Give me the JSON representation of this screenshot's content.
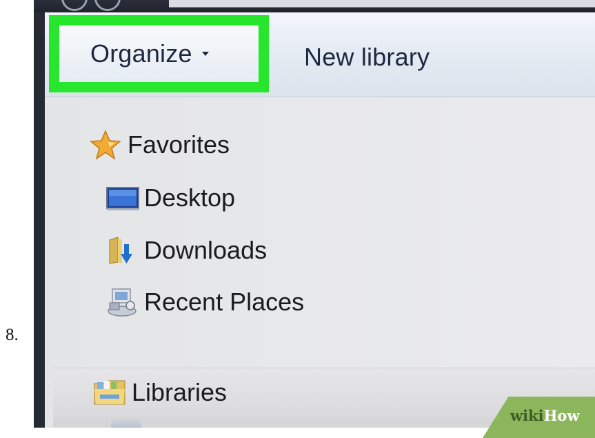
{
  "step": {
    "number": "8."
  },
  "toolbar": {
    "organize_label": "Organize",
    "new_library_label": "New library",
    "highlight_color": "#27e62d"
  },
  "navigation": {
    "favorites": {
      "label": "Favorites",
      "icon": "star-icon",
      "items": [
        {
          "label": "Desktop",
          "icon": "desktop-icon"
        },
        {
          "label": "Downloads",
          "icon": "downloads-folder-icon"
        },
        {
          "label": "Recent Places",
          "icon": "recent-places-icon"
        }
      ]
    },
    "libraries": {
      "label": "Libraries",
      "icon": "libraries-folder-icon"
    }
  },
  "watermark": {
    "part1": "wiki",
    "part2": "How"
  }
}
